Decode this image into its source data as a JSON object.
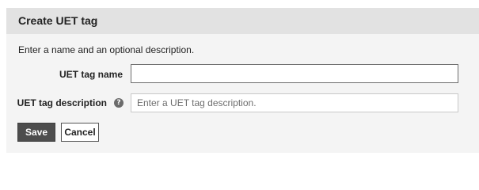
{
  "panel": {
    "title": "Create UET tag",
    "intro": "Enter a name and an optional description."
  },
  "form": {
    "name_label": "UET tag name",
    "name_value": "",
    "description_label": "UET tag description",
    "description_placeholder": "Enter a UET tag description.",
    "description_value": "",
    "help_icon": "question-mark-circle",
    "help_glyph": "?"
  },
  "actions": {
    "save_label": "Save",
    "cancel_label": "Cancel"
  },
  "colors": {
    "header_background": "#e2e2e2",
    "panel_background": "#f4f4f4",
    "save_button": "#4d4d4d"
  }
}
